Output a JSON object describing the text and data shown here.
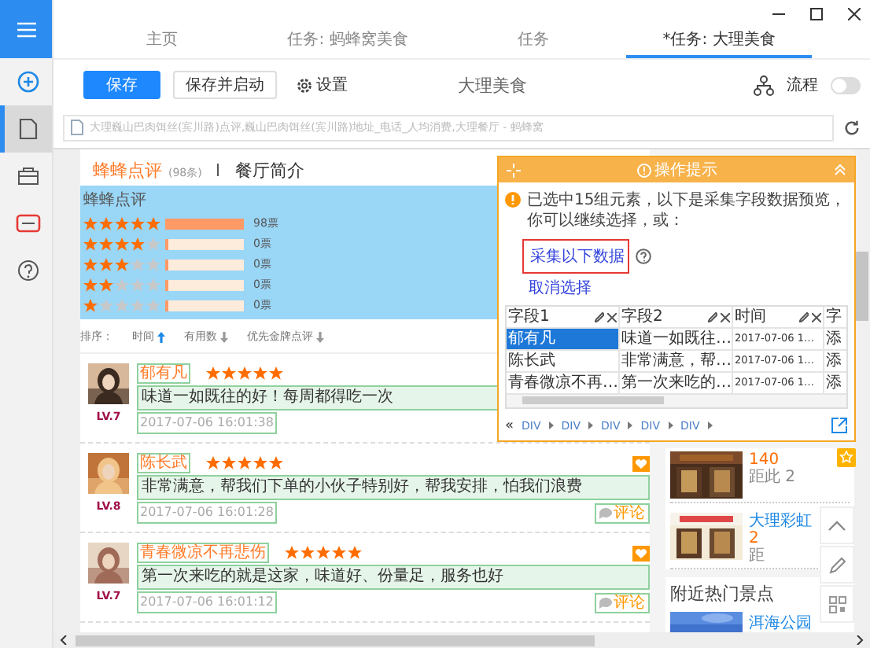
{
  "tabs": [
    {
      "label": "主页",
      "selected": false
    },
    {
      "label": "任务: 蚂蜂窝美食",
      "selected": false
    },
    {
      "label": "任务",
      "selected": false
    },
    {
      "label": "*任务: 大理美食",
      "selected": true
    }
  ],
  "sidebar": {
    "items": [
      {
        "kind": "add",
        "selected": false
      },
      {
        "kind": "document",
        "selected": true
      },
      {
        "kind": "box",
        "selected": false
      },
      {
        "kind": "card",
        "selected": false
      },
      {
        "kind": "help",
        "selected": false
      }
    ]
  },
  "toolbar": {
    "save": "保存",
    "save_start": "保存并启动",
    "settings": "设置",
    "task_name": "大理美食",
    "flow": {
      "label": "流程",
      "on": false
    }
  },
  "address_bar": {
    "url": "大理巍山巴肉饵丝(宾川路)点评,巍山巴肉饵丝(宾川路)地址_电话_人均消费,大理餐厅 - 蚂蜂窝"
  },
  "page": {
    "tabs": {
      "reviews": "蜂蜂点评",
      "count": "(98条)",
      "intro": "餐厅简介"
    },
    "rating": {
      "title": "蜂蜂点评",
      "rows": [
        {
          "stars": 5,
          "level": 1,
          "votes": "98票"
        },
        {
          "stars": 4,
          "level": 0,
          "votes": "0票"
        },
        {
          "stars": 3,
          "level": 0,
          "votes": "0票"
        },
        {
          "stars": 2,
          "level": 0,
          "votes": "0票"
        },
        {
          "stars": 1,
          "level": 0,
          "votes": "0票"
        }
      ]
    },
    "sort": {
      "label": "排序：",
      "options": [
        {
          "label": "时间",
          "selected": true
        },
        {
          "label": "有用数",
          "selected": false
        },
        {
          "label": "优先金牌点评",
          "selected": false
        }
      ]
    },
    "reviews": [
      {
        "name": "郁有凡",
        "stars": 5,
        "text": "味道一如既往的好！每周都得吃一次",
        "time": "2017-07-06 16:01:38",
        "level": "LV.7"
      },
      {
        "name": "陈长武",
        "stars": 5,
        "text": "非常满意，帮我们下单的小伙子特别好，帮我安排，怕我们浪费",
        "time": "2017-07-06 16:01:28",
        "level": "LV.8",
        "comment": "评论"
      },
      {
        "name": "青春微凉不再悲伤",
        "stars": 5,
        "text": "第一次来吃的就是这家，味道好、份量足，服务也好",
        "time": "2017-07-06 16:01:12",
        "level": "LV.7",
        "comment": "评论"
      }
    ],
    "aside": {
      "listings": [
        {
          "price": "140",
          "distance": "距此 2"
        },
        {
          "name": "大理彩虹",
          "price": "2",
          "distance": "距"
        }
      ],
      "section_title": "附近热门景点",
      "spot": "洱海公园"
    }
  },
  "popup": {
    "title": "操作提示",
    "message": "已选中15组元素，以下是采集字段数据预览，你可以继续选择，或：",
    "collect": "采集以下数据",
    "cancel": "取消选择",
    "columns": [
      "字段1",
      "字段2",
      "时间",
      "字"
    ],
    "rows": [
      {
        "cells": [
          "郁有凡",
          "味道一如既往…",
          "2017-07-06 1…",
          "添"
        ],
        "selected": true
      },
      {
        "cells": [
          "陈长武",
          "非常满意，帮…",
          "2017-07-06 1…",
          "添"
        ],
        "selected": false
      },
      {
        "cells": [
          "青春微凉不再…",
          "第一次来吃的…",
          "2017-07-06 1…",
          "添"
        ],
        "selected": false
      }
    ],
    "breadcrumb_first": "«",
    "breadcrumb": [
      "DIV",
      "DIV",
      "DIV",
      "DIV",
      "DIV"
    ]
  }
}
